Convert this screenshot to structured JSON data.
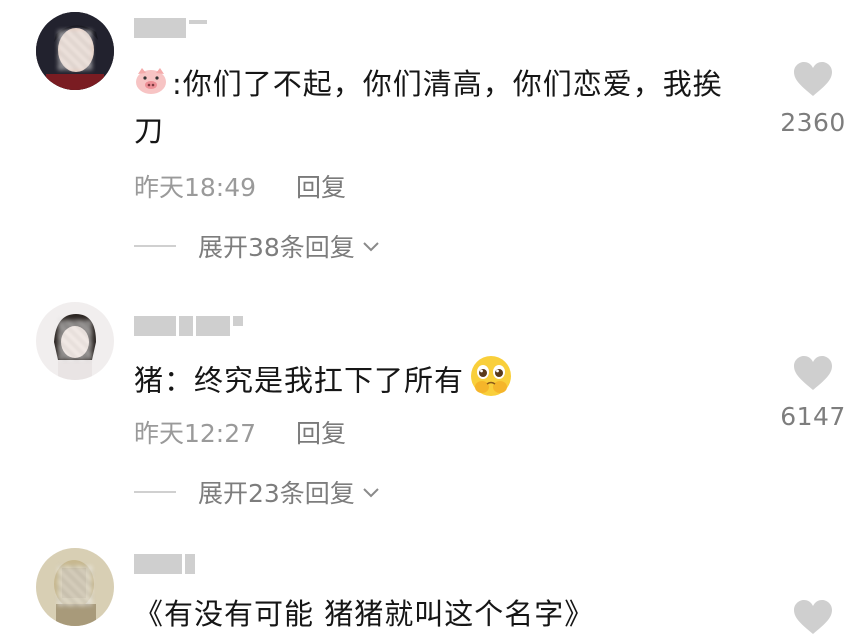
{
  "comments": [
    {
      "username": "",
      "text_prefix_icon": "pig-face-emoji",
      "text": ":你们了不起，你们清高，你们恋爱，我挨\n刀",
      "time": "昨天18:49",
      "reply_label": "回复",
      "expand_label": "展开38条回复",
      "likes": "2360"
    },
    {
      "username": "",
      "text": "猪：终究是我扛下了所有",
      "text_suffix_icon": "pleading-face-emoji",
      "time": "昨天12:27",
      "reply_label": "回复",
      "expand_label": "展开23条回复",
      "likes": "6147"
    },
    {
      "username": "",
      "text": "《有没有可能 猪猪就叫这个名字》",
      "likes": ""
    }
  ],
  "colors": {
    "text": "#161616",
    "meta": "#9a9a9a",
    "heart": "#cfcfcf"
  }
}
